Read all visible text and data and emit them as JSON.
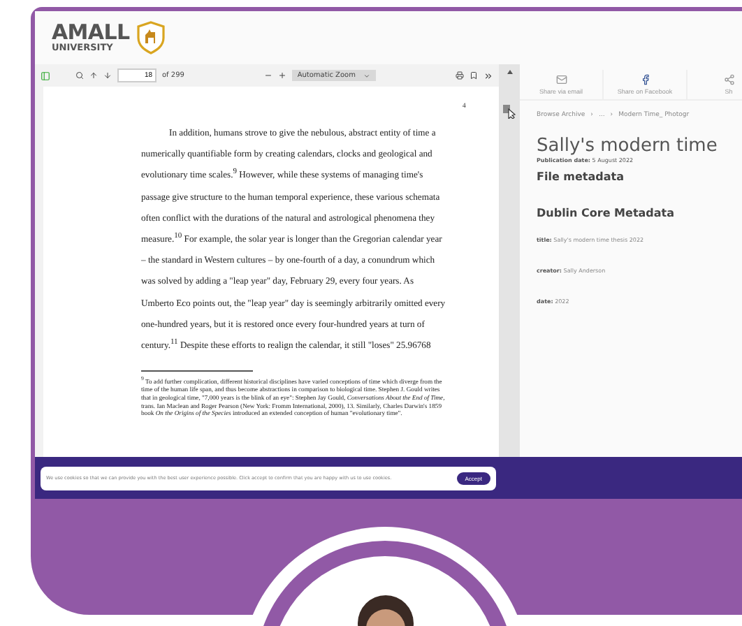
{
  "header": {
    "logo_title": "AMALL",
    "logo_subtitle": "UNIVERSITY"
  },
  "pdf_toolbar": {
    "page": "18",
    "page_count": "of 299",
    "zoom": "Automatic Zoom"
  },
  "pdf_page": {
    "page_number": "4",
    "paragraph": "In addition, humans strove to give the nebulous, abstract entity of time a numerically quantifiable form by creating calendars, clocks and geological and evolutionary time scales.$^{9}$ However, while these systems of managing time's passage give structure to the human temporal experience, these various schemata often conflict with the durations of the natural and astrological phenomena they measure.$^{10}$ For example, the solar year is longer than the Gregorian calendar year – the standard in Western cultures – by one-fourth of a day, a conundrum which was solved by adding a \"leap year\" day, February 29, every four years. As Umberto Eco points out, the \"leap year\" day is seemingly arbitrarily omitted every one-hundred years, but it is restored once every four-hundred years at turn of century.$^{11}$ Despite these efforts to realign the calendar, it still \"loses\" 25.96768",
    "footnote": "$^{9}$ To add further complication, different historical disciplines have varied conceptions of time which diverge from the time of the human life span, and thus become abstractions in comparison to biological time. Stephen J. Gould writes that in geological time, \"7,000 years is the blink of an eye\": Stephen Jay Gould, *Conversations About the End of Time*, trans. Ian Maclean and Roger Pearson (New York: Fromm International, 2000), 13. Similarly, Charles Darwin's 1859 book *On the Origins of the Species* introduced an extended conception of human \"evolutionary time\"."
  },
  "share": [
    {
      "kind": "email",
      "label": "Share via email"
    },
    {
      "kind": "facebook",
      "label": "Share on Facebook"
    },
    {
      "kind": "other",
      "label": "Sh"
    }
  ],
  "record": {
    "breadcrumb": [
      {
        "label": "Browse Archive"
      },
      {
        "separator": "›",
        "label": "..."
      },
      {
        "separator": "›",
        "label": "Modern Time_ Photogr"
      }
    ],
    "title": "Sally's modern time",
    "publication_label": "Publication date:",
    "publication_date": "5 August 2022",
    "file_metadata": "File metadata",
    "dublin_core": "Dublin Core Metadata",
    "fields": [
      {
        "label": "title:",
        "value": "Sally's modern time thesis 2022"
      },
      {
        "label": "creator:",
        "value": "Sally Anderson"
      },
      {
        "label": "date:",
        "value": "2022"
      }
    ]
  },
  "cookie": {
    "text": "We use cookies so that we can provide you with the best user experience possible. Click accept to confirm that you are happy with us to use cookies.",
    "button": "Accept"
  }
}
